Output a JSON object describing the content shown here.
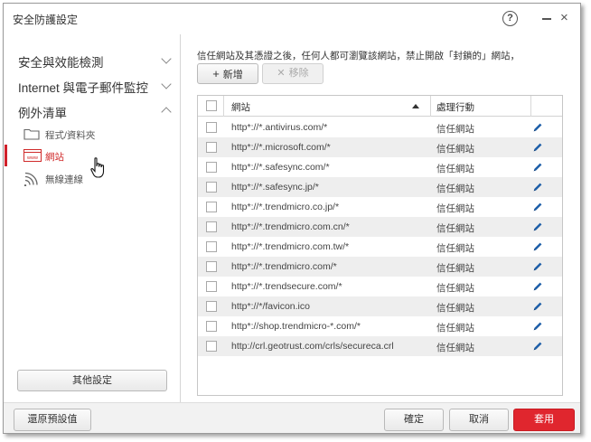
{
  "window": {
    "title": "安全防護設定",
    "help_label": "?",
    "close_label": "×"
  },
  "sidebar": {
    "sections": [
      {
        "label": "安全與效能檢測",
        "expanded": false
      },
      {
        "label": "Internet 與電子郵件監控",
        "expanded": false
      },
      {
        "label": "例外清單",
        "expanded": true
      }
    ],
    "sub_items": [
      {
        "label": "程式/資料夾",
        "icon": "folder-icon",
        "active": false
      },
      {
        "label": "網站",
        "icon": "www-icon",
        "active": true
      },
      {
        "label": "無線連線",
        "icon": "wifi-icon",
        "active": false
      }
    ],
    "other_settings_label": "其他設定"
  },
  "main": {
    "description": "信任網站及其憑證之後，任何人都可瀏覽該網站，禁止開啟「封鎖的」網站，",
    "add_button": {
      "symbol": "+",
      "label": "新增"
    },
    "remove_button": {
      "symbol": "✕",
      "label": "移除"
    },
    "table": {
      "columns": [
        "網站",
        "處理行動"
      ],
      "rows": [
        {
          "url": "http*://*.antivirus.com/*",
          "action": "信任網站"
        },
        {
          "url": "http*://*.microsoft.com/*",
          "action": "信任網站"
        },
        {
          "url": "http*://*.safesync.com/*",
          "action": "信任網站"
        },
        {
          "url": "http*://*.safesync.jp/*",
          "action": "信任網站"
        },
        {
          "url": "http*://*.trendmicro.co.jp/*",
          "action": "信任網站"
        },
        {
          "url": "http*://*.trendmicro.com.cn/*",
          "action": "信任網站"
        },
        {
          "url": "http*://*.trendmicro.com.tw/*",
          "action": "信任網站"
        },
        {
          "url": "http*://*.trendmicro.com/*",
          "action": "信任網站"
        },
        {
          "url": "http*://*.trendsecure.com/*",
          "action": "信任網站"
        },
        {
          "url": "http*://*/favicon.ico",
          "action": "信任網站"
        },
        {
          "url": "http*://shop.trendmicro-*.com/*",
          "action": "信任網站"
        },
        {
          "url": "http://crl.geotrust.com/crls/secureca.crl",
          "action": "信任網站"
        }
      ]
    }
  },
  "footer": {
    "restore_defaults_label": "還原預設值",
    "ok_label": "確定",
    "cancel_label": "取消",
    "apply_label": "套用"
  },
  "colors": {
    "accent_red": "#e0262e",
    "edit_icon_blue": "#1e5fa8"
  }
}
